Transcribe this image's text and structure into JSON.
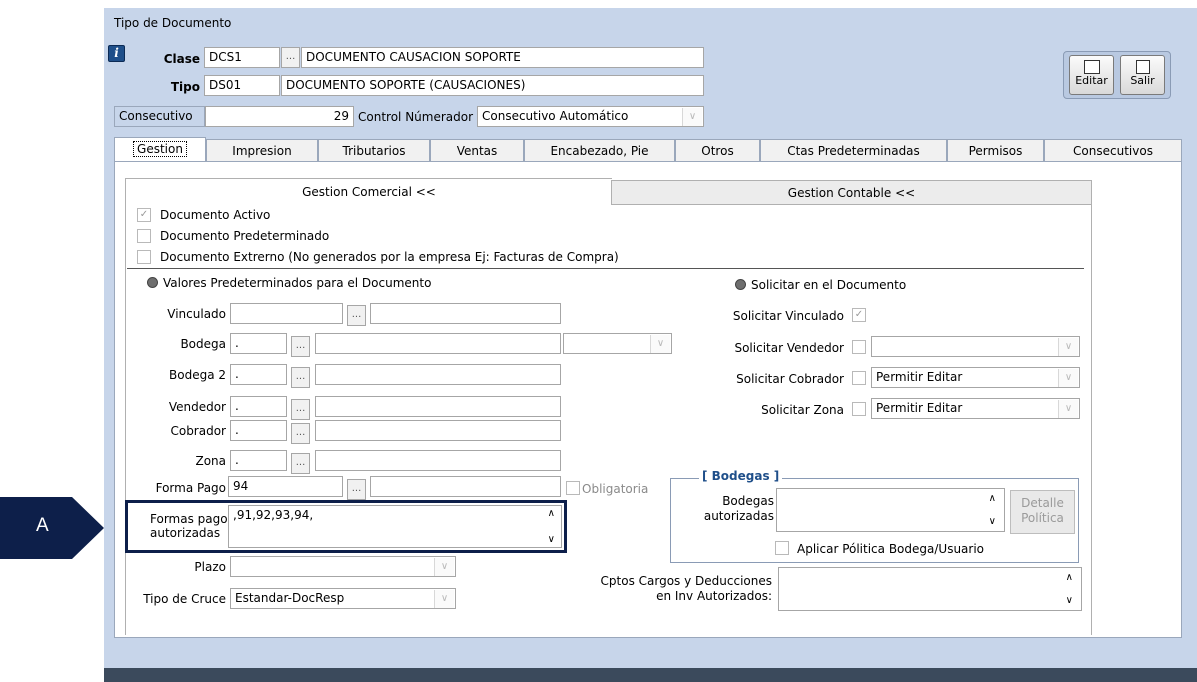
{
  "window": {
    "title": "Tipo de Documento"
  },
  "header": {
    "clase_label": "Clase",
    "clase_code": "DCS1",
    "clase_name": "DOCUMENTO CAUSACION SOPORTE",
    "tipo_label": "Tipo",
    "tipo_code": "DS01",
    "tipo_name": "DOCUMENTO SOPORTE (CAUSACIONES)",
    "consecutivo_label": "Consecutivo",
    "consecutivo_value": "29",
    "control_label": "Control Númerador :",
    "control_value": "Consecutivo Automático",
    "ellipsis": "..."
  },
  "toolbar": {
    "edit_label": "Editar",
    "exit_label": "Salir"
  },
  "tabs": [
    "Gestion",
    "Impresion",
    "Tributarios",
    "Ventas",
    "Encabezado, Pie",
    "Otros",
    "Ctas Predeterminadas",
    "Permisos",
    "Consecutivos"
  ],
  "subtabs": {
    "comercial": "Gestion Comercial <<",
    "contable": "Gestion Contable <<"
  },
  "checks": {
    "activo": "Documento Activo",
    "predeterminado": "Documento Predeterminado",
    "externo": "Documento Extrerno (No generados por la empresa  Ej: Facturas de Compra)"
  },
  "sections": {
    "valores": "Valores Predeterminados para el Documento",
    "solicitar": "Solicitar en el Documento"
  },
  "left": {
    "vinculado": "Vinculado",
    "bodega": "Bodega",
    "bodega_value": ".",
    "bodega2": "Bodega 2",
    "bodega2_value": ".",
    "vendedor": "Vendedor",
    "vendedor_value": ".",
    "cobrador": "Cobrador",
    "cobrador_value": ".",
    "zona": "Zona",
    "zona_value": ".",
    "forma_pago": "Forma Pago",
    "forma_pago_value": "94",
    "obligatoria": "Obligatoria",
    "formas_pago_line1": "Formas pago",
    "formas_pago_line2": "autorizadas",
    "formas_pago_value": ",91,92,93,94,",
    "plazo": "Plazo",
    "tipo_cruce": "Tipo de Cruce",
    "tipo_cruce_value": "Estandar-DocResp"
  },
  "right": {
    "solicitar_vinculado": "Solicitar Vinculado",
    "solicitar_vendedor": "Solicitar Vendedor",
    "solicitar_cobrador": "Solicitar Cobrador",
    "cobrador_mode": "Permitir Editar",
    "solicitar_zona": "Solicitar Zona",
    "zona_mode": "Permitir Editar",
    "bodegas_title": "[ Bodegas ]",
    "bodegas_auth_line1": "Bodegas",
    "bodegas_auth_line2": "autorizadas",
    "detalle_line1": "Detalle",
    "detalle_line2": "Política",
    "aplicar_politica": "Aplicar Pólitica Bodega/Usuario",
    "cptos_line1": "Cptos Cargos y Deducciones",
    "cptos_line2": "en Inv Autorizados:"
  },
  "callout": {
    "label": "A",
    "color": "#0d1f4a"
  }
}
